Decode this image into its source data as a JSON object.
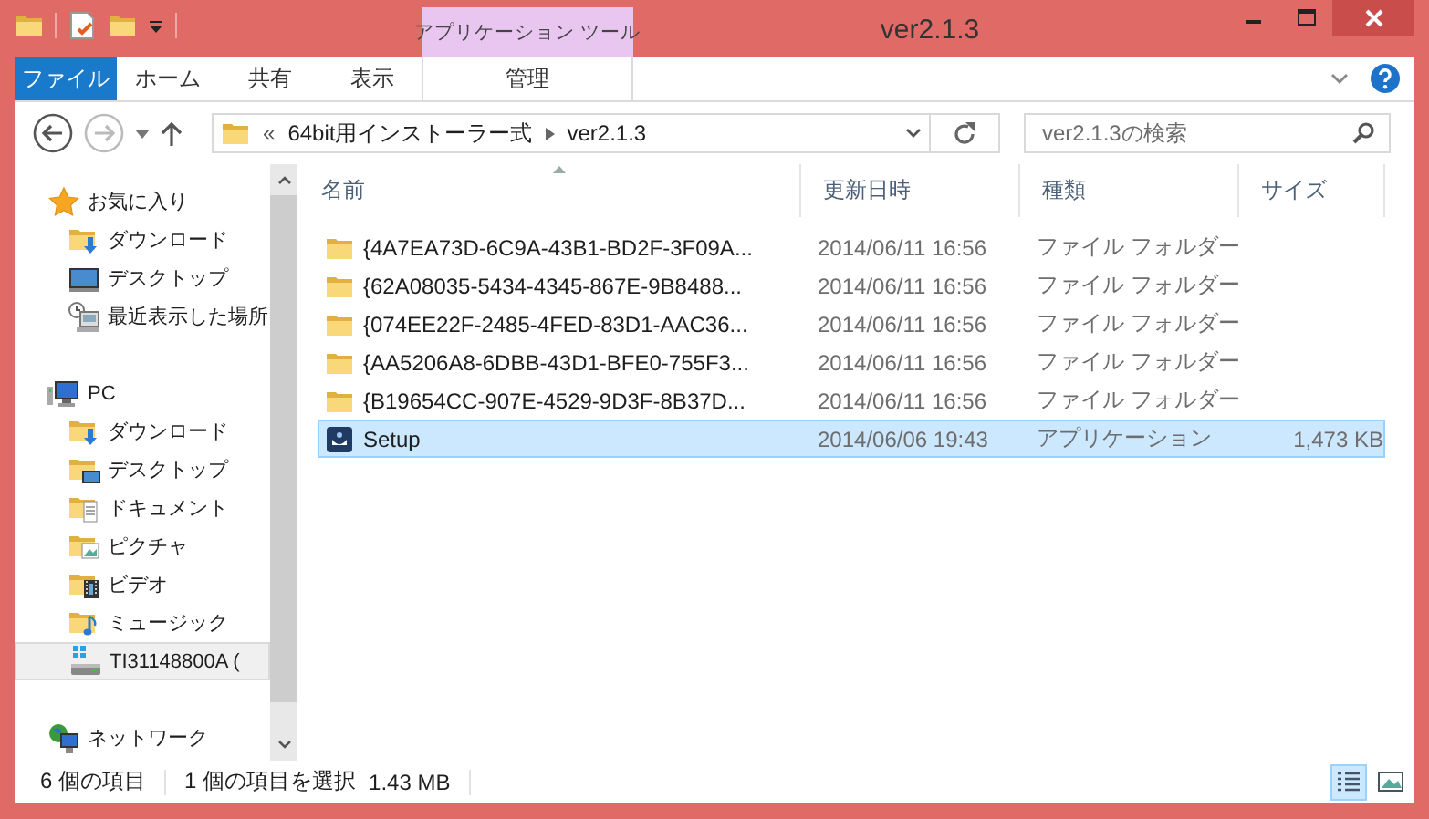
{
  "window": {
    "title": "ver2.1.3"
  },
  "contextual_tab_group": {
    "label": "アプリケーション ツール"
  },
  "ribbon_tabs": [
    {
      "label": "ファイル",
      "kind": "file",
      "selected": false
    },
    {
      "label": "ホーム",
      "kind": "tab",
      "selected": false
    },
    {
      "label": "共有",
      "kind": "tab",
      "selected": false
    },
    {
      "label": "表示",
      "kind": "tab",
      "selected": false
    },
    {
      "label": "管理",
      "kind": "contextual",
      "selected": false
    }
  ],
  "address_bar": {
    "overflow": "«",
    "segments": [
      "64bit用インストーラー式",
      "ver2.1.3"
    ]
  },
  "search": {
    "placeholder": "ver2.1.3の検索"
  },
  "navigation": [
    {
      "label": "お気に入り",
      "kind": "favorites",
      "selected": false,
      "children": [
        {
          "label": "ダウンロード",
          "kind": "downloads",
          "selected": false
        },
        {
          "label": "デスクトップ",
          "kind": "desktop",
          "selected": false
        },
        {
          "label": "最近表示した場所",
          "kind": "recent",
          "selected": false
        }
      ]
    },
    {
      "label": "PC",
      "kind": "pc",
      "selected": false,
      "children": [
        {
          "label": "ダウンロード",
          "kind": "downloads",
          "selected": false
        },
        {
          "label": "デスクトップ",
          "kind": "desktop_folder",
          "selected": false
        },
        {
          "label": "ドキュメント",
          "kind": "documents",
          "selected": false
        },
        {
          "label": "ピクチャ",
          "kind": "pictures",
          "selected": false
        },
        {
          "label": "ビデオ",
          "kind": "videos",
          "selected": false
        },
        {
          "label": "ミュージック",
          "kind": "music",
          "selected": false
        },
        {
          "label": "TI31148800A (",
          "kind": "drive",
          "selected": true
        }
      ]
    },
    {
      "label": "ネットワーク",
      "kind": "network",
      "selected": false
    }
  ],
  "file_list": {
    "columns": [
      {
        "label": "名前",
        "sorted": true
      },
      {
        "label": "更新日時",
        "sorted": false
      },
      {
        "label": "種類",
        "sorted": false
      },
      {
        "label": "サイズ",
        "sorted": false
      }
    ],
    "rows": [
      {
        "kind": "folder",
        "name": "{4A7EA73D-6C9A-43B1-BD2F-3F09A...",
        "modified": "2014/06/11 16:56",
        "type": "ファイル フォルダー",
        "selected": false
      },
      {
        "kind": "folder",
        "name": "{62A08035-5434-4345-867E-9B8488...",
        "modified": "2014/06/11 16:56",
        "type": "ファイル フォルダー",
        "selected": false
      },
      {
        "kind": "folder",
        "name": "{074EE22F-2485-4FED-83D1-AAC36...",
        "modified": "2014/06/11 16:56",
        "type": "ファイル フォルダー",
        "selected": false
      },
      {
        "kind": "folder",
        "name": "{AA5206A8-6DBB-43D1-BFE0-755F3...",
        "modified": "2014/06/11 16:56",
        "type": "ファイル フォルダー",
        "selected": false
      },
      {
        "kind": "folder",
        "name": "{B19654CC-907E-4529-9D3F-8B37D...",
        "modified": "2014/06/11 16:56",
        "type": "ファイル フォルダー",
        "selected": false
      },
      {
        "kind": "application",
        "name": "Setup",
        "modified": "2014/06/06 19:43",
        "type": "アプリケーション",
        "size": "1,473 KB",
        "selected": true
      }
    ]
  },
  "status_bar": {
    "item_count": "6 個の項目",
    "selection": "1 個の項目を選択",
    "selection_size": "1.43 MB",
    "views": [
      {
        "kind": "details",
        "selected": true
      },
      {
        "kind": "large_icons",
        "selected": false
      }
    ]
  }
}
